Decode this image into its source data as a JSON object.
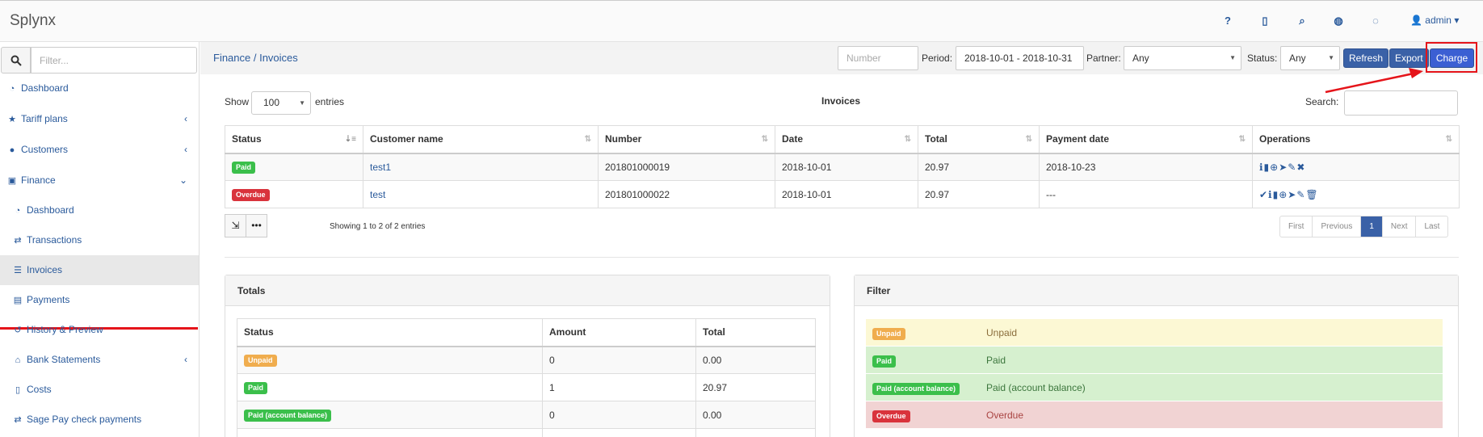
{
  "app": {
    "title": "Splynx",
    "user": "admin"
  },
  "topnav_icons": [
    "help-icon",
    "book-icon",
    "search-icon",
    "globe-icon",
    "chat-icon",
    "user-icon"
  ],
  "sidebar": {
    "filter_placeholder": "Filter...",
    "items": [
      {
        "label": "Dashboard",
        "icon": "dashboard-icon"
      },
      {
        "label": "Tariff plans",
        "icon": "star-icon",
        "expandable": true
      },
      {
        "label": "Customers",
        "icon": "user-icon",
        "expandable": true
      },
      {
        "label": "Finance",
        "icon": "finance-icon",
        "expanded": true
      },
      {
        "label": "Dashboard",
        "icon": "dashboard-icon",
        "sub": true
      },
      {
        "label": "Transactions",
        "icon": "exchange-icon",
        "sub": true
      },
      {
        "label": "Invoices",
        "icon": "list-icon",
        "sub": true,
        "active": true
      },
      {
        "label": "Payments",
        "icon": "payments-icon",
        "sub": true
      },
      {
        "label": "History & Preview",
        "icon": "history-icon",
        "sub": true
      },
      {
        "label": "Bank Statements",
        "icon": "bank-icon",
        "sub": true,
        "expandable": true
      },
      {
        "label": "Costs",
        "icon": "file-icon",
        "sub": true
      },
      {
        "label": "Sage Pay check payments",
        "icon": "exchange-icon",
        "sub": true
      }
    ]
  },
  "header": {
    "breadcrumb": "Finance / Invoices",
    "number_placeholder": "Number",
    "period_label": "Period:",
    "period_value": "2018-10-01 - 2018-10-31",
    "partner_label": "Partner:",
    "partner_value": "Any",
    "status_label": "Status:",
    "status_value": "Any",
    "refresh_label": "Refresh",
    "export_label": "Export",
    "charge_label": "Charge"
  },
  "table": {
    "show_label": "Show",
    "show_value": "100",
    "entries_label": "entries",
    "title": "Invoices",
    "search_label": "Search:",
    "columns": [
      "Status",
      "Customer name",
      "Number",
      "Date",
      "Total",
      "Payment date",
      "Operations"
    ],
    "rows": [
      {
        "status": "Paid",
        "customer": "test1",
        "number": "201801000019",
        "date": "2018-10-01",
        "total": "20.97",
        "payment_date": "2018-10-23",
        "ops": "ℹ▮⊕➤✎✖"
      },
      {
        "status": "Overdue",
        "customer": "test",
        "number": "201801000022",
        "date": "2018-10-01",
        "total": "20.97",
        "payment_date": "---",
        "ops": "✔ℹ▮⊕➤✎🗑"
      }
    ],
    "showing_text": "Showing 1 to 2 of 2 entries",
    "pager": [
      "First",
      "Previous",
      "1",
      "Next",
      "Last"
    ]
  },
  "totals": {
    "title": "Totals",
    "columns": [
      "Status",
      "Amount",
      "Total"
    ],
    "rows": [
      {
        "status": "Unpaid",
        "amount": "0",
        "total": "0.00"
      },
      {
        "status": "Paid",
        "amount": "1",
        "total": "20.97"
      },
      {
        "status": "Paid (account balance)",
        "amount": "0",
        "total": "0.00"
      }
    ]
  },
  "filter": {
    "title": "Filter",
    "rows": [
      {
        "badge": "Unpaid",
        "label": "Unpaid"
      },
      {
        "badge": "Paid",
        "label": "Paid"
      },
      {
        "badge": "Paid (account balance)",
        "label": "Paid (account balance)"
      },
      {
        "badge": "Overdue",
        "label": "Overdue"
      }
    ]
  },
  "colors": {
    "accent": "#3a61a7",
    "link": "#2a5a9b",
    "paid": "#3bbf4b",
    "overdue": "#d9333c",
    "unpaid": "#f0ad4e",
    "highlight": "#e5141a"
  }
}
